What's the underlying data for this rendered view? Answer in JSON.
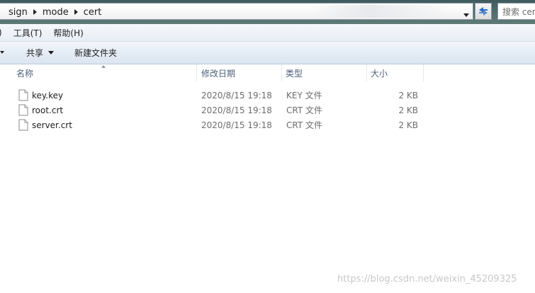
{
  "address_bar": {
    "breadcrumbs": [
      "sign",
      "mode",
      "cert"
    ],
    "search_placeholder": "搜索 cert"
  },
  "menu_bar": {
    "items": [
      ")",
      "工具(T)",
      "帮助(H)"
    ]
  },
  "toolbar": {
    "share_label": "共享",
    "new_folder_label": "新建文件夹"
  },
  "file_list": {
    "columns": {
      "name": "名称",
      "date_modified": "修改日期",
      "type": "类型",
      "size": "大小"
    },
    "files": [
      {
        "name": "key.key",
        "date_modified": "2020/8/15 19:18",
        "type": "KEY 文件",
        "size": "2 KB"
      },
      {
        "name": "root.crt",
        "date_modified": "2020/8/15 19:18",
        "type": "CRT 文件",
        "size": "2 KB"
      },
      {
        "name": "server.crt",
        "date_modified": "2020/8/15 19:18",
        "type": "CRT 文件",
        "size": "2 KB"
      }
    ]
  },
  "watermark": "https://blog.csdn.net/weixin_45209325",
  "colors": {
    "title_strip": "#4c6a6a",
    "toolbar_bg": "#e3ebf5",
    "header_text": "#4c607a",
    "secondary_text": "#6d6d6d"
  }
}
